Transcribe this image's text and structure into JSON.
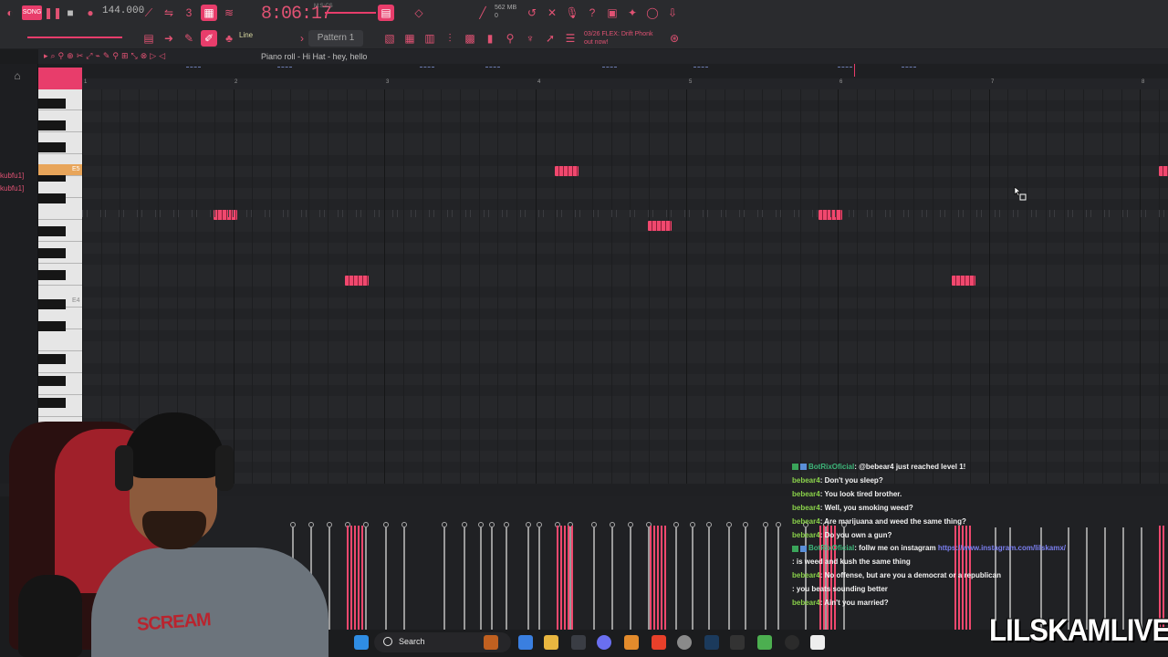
{
  "toolbar": {
    "song_label": "SONG",
    "tempo": "144.000",
    "time": "8:06:17",
    "time_sub": "M:S:CS",
    "memory": "562 MB",
    "memory_sub": "0",
    "snap": "Line",
    "pattern": "Pattern 1",
    "news_line1": "03/26 FLEX: Drift Phonk",
    "news_line2": "out now!"
  },
  "piano_roll": {
    "title": "Piano roll - Hi Hat - hey, hello",
    "bar_numbers": [
      "1",
      "2",
      "3",
      "4",
      "5",
      "6",
      "7",
      "8"
    ],
    "key_labels": [
      "E5",
      "E4"
    ]
  },
  "browser": {
    "channel_labels": [
      "kubfu1]",
      "kubfu1]"
    ]
  },
  "chat": [
    {
      "user": "BotRixOficial",
      "type": "bot",
      "msg": ": @bebear4 just reached level 1!"
    },
    {
      "user": "bebear4",
      "type": "user",
      "msg": ": Don't you sleep?"
    },
    {
      "user": "bebear4",
      "type": "user",
      "msg": ": You look tired brother."
    },
    {
      "user": "bebear4",
      "type": "user",
      "msg": ": Well, you smoking weed?"
    },
    {
      "user": "bebear4",
      "type": "user",
      "msg": ": Are marijuana and weed the same thing?"
    },
    {
      "user": "bebear4",
      "type": "user",
      "msg": ": Do you own a gun?"
    },
    {
      "user": "BotRixOficial",
      "type": "bot",
      "msg": ": follw me on instagram ",
      "link": "https://www.instagram.com/lilskamx/"
    },
    {
      "user": "           ",
      "type": "red",
      "msg": ": is weed and kush the same thing"
    },
    {
      "user": "bebear4",
      "type": "user",
      "msg": ": No offense, but are you a democrat or a republican"
    },
    {
      "user": "           ",
      "type": "red",
      "msg": ": you beats sounding better"
    },
    {
      "user": "bebear4",
      "type": "user",
      "msg": ": Ain't you married?"
    }
  ],
  "taskbar": {
    "search_label": "Search"
  },
  "webcam": {
    "shirt_print": "SCREAM"
  },
  "brand": "LILSKAMLIVE",
  "colors": {
    "accent": "#f0486e",
    "background": "#26272a"
  }
}
